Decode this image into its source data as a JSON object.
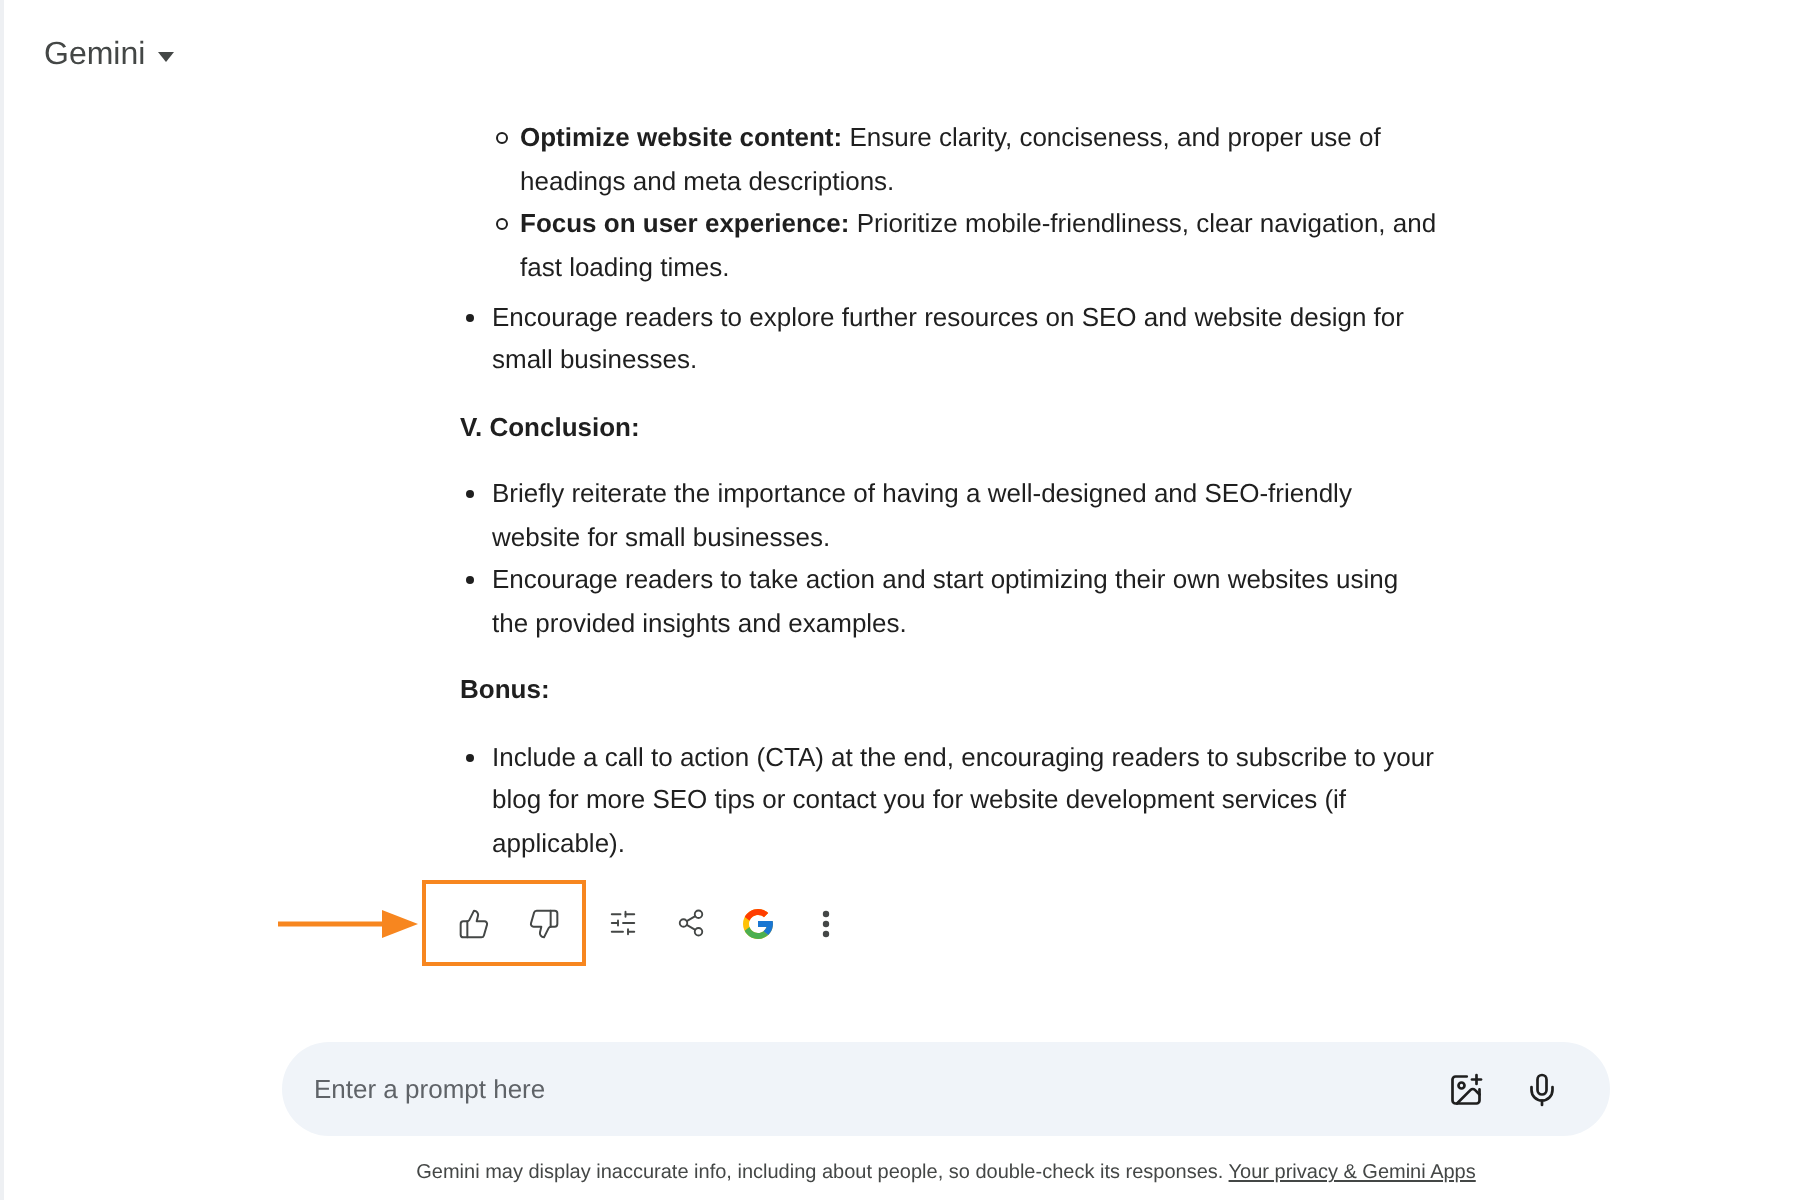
{
  "header": {
    "title": "Gemini"
  },
  "response": {
    "blocks": [
      {
        "kind": "list",
        "items": [
          {
            "children": [
              {
                "text": "**Optimize website content:** Ensure clarity, conciseness, and proper use of headings and meta descriptions."
              },
              {
                "text": "**Focus on user experience:** Prioritize mobile-friendliness, clear navigation, and fast loading times."
              }
            ]
          },
          {
            "text": "Encourage readers to explore further resources on SEO and website design for small businesses."
          }
        ]
      },
      {
        "kind": "heading",
        "text": "V. Conclusion:"
      },
      {
        "kind": "list",
        "items": [
          {
            "text": "Briefly reiterate the importance of having a well-designed and SEO-friendly website for small businesses."
          },
          {
            "text": "Encourage readers to take action and start optimizing their own websites using the provided insights and examples."
          }
        ]
      },
      {
        "kind": "heading",
        "text": "Bonus:"
      },
      {
        "kind": "list",
        "items": [
          {
            "text": "Include a call to action (CTA) at the end, encouraging readers to subscribe to your blog for more SEO tips or contact you for website development services (if applicable)."
          }
        ]
      }
    ]
  },
  "action_groups": [
    {
      "highlighted": true,
      "actions": [
        {
          "kind": "thumb-up"
        },
        {
          "kind": "thumb-down"
        }
      ]
    },
    {
      "highlighted": false,
      "actions": [
        {
          "kind": "modify"
        },
        {
          "kind": "share"
        },
        {
          "kind": "google"
        },
        {
          "kind": "more"
        }
      ]
    }
  ],
  "prompt": {
    "placeholder": "Enter a prompt here",
    "tools": [
      {
        "kind": "image-add"
      },
      {
        "kind": "mic"
      }
    ]
  },
  "footer": {
    "text": "Gemini may display inaccurate info, including about people, so double-check its responses.",
    "link": "Your privacy & Gemini Apps"
  }
}
